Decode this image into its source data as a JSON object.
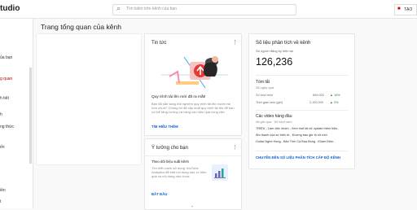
{
  "header": {
    "logo_text": "tudio",
    "search_placeholder": "Tìm kiếm trên kênh của bạn",
    "create_label": "TẠO"
  },
  "sidebar": {
    "items": [
      {
        "label": "ủa bạn",
        "active": false
      },
      {
        "label": "g quan",
        "active": true
      },
      {
        "label": "h tiết",
        "active": false
      },
      {
        "label": "h",
        "active": false
      },
      {
        "label": "ng thức",
        "active": false
      },
      {
        "label": "ến",
        "active": false
      },
      {
        "label": "iền",
        "active": false
      },
      {
        "label": "t",
        "active": false
      }
    ]
  },
  "page": {
    "title": "Trang tổng quan của kênh"
  },
  "news": {
    "title": "Tin tức",
    "headline": "Quy trình tải lên mới đã ra mắt!",
    "body": "Bạn đã sẵn sàng trải nghiệm quy trình tải lên mượt mà hơn chưa? Chúng tôi đã cập nhật quy trình tải lên để bạn có thể tăng cường và nâng cao hiệu quả công việc",
    "link": "TÌM HIỂU THÊM"
  },
  "ideas": {
    "title": "Ý tưởng cho bạn",
    "heading": "Theo dõi hiệu suất kênh",
    "body": "Tìm hiểu cách sử dụng YouTube Analytics để biết nội dung nào có hiệu quả và nội dung nào chưa",
    "link": "BẮT ĐẦU"
  },
  "analytics": {
    "title": "Số liệu phân tích về kênh",
    "subs_label": "Số người đăng ký hiện tại",
    "subs_value": "126,236",
    "summary_title": "Tóm tắt",
    "summary_sub": "28 ngày qua",
    "rows": [
      {
        "label": "Số lượt xem",
        "value": "609,000",
        "trend": "10%"
      },
      {
        "label": "Thời gian xem (giờ)",
        "value": "2,100,000",
        "trend": "0%"
      }
    ],
    "top_videos_title": "Các video hàng đầu",
    "top_videos_sub": "48 giờ qua · Số lượt xem",
    "videos": [
      {
        "title": "TRIỆU - Làm việc nhóm - Xem mới tái xử update thêm hiệu..",
        "views": ""
      },
      {
        "title": "Âm thanh của sự biến tri - Đương bao giờ bị xử mới",
        "views": ""
      },
      {
        "title": "Guitar Nghe Hồng - Bản Tình Ca Bùa Bồng - Khám Đêm..",
        "views": ""
      }
    ],
    "link": "CHUYỂN ĐẾN SỐ LIỆU PHÂN TÍCH CẤP ĐỘ KÊNH"
  }
}
